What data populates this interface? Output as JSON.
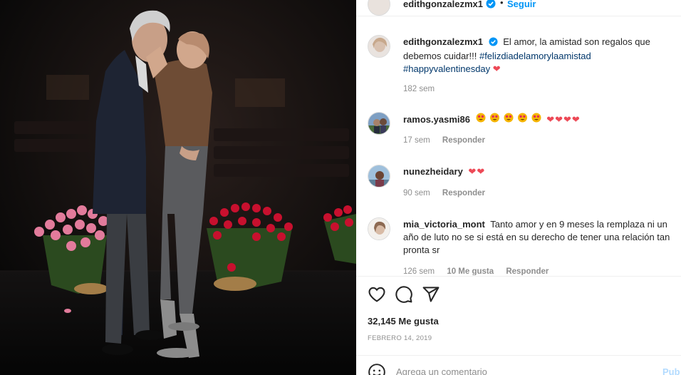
{
  "post": {
    "author": "edithgonzalezmx1",
    "follow_label": "Seguir",
    "dot": "•",
    "verified_icon": "verified-badge-icon",
    "caption": {
      "text": "El amor, la amistad son regalos que debemos cuidar!!!",
      "hashtag_1": "#felizdiadelamorylaamistad",
      "hashtag_2": "#happyvalentinesday",
      "age": "182 sem"
    },
    "comments": [
      {
        "username": "ramos.yasmi86",
        "age": "17 sem",
        "reply_label": "Responder"
      },
      {
        "username": "nunezheidary",
        "age": "90 sem",
        "reply_label": "Responder"
      },
      {
        "username": "mia_victoria_mont",
        "text": "Tanto amor y en 9 meses la remplaza ni un año de luto no se si está en su derecho de tener una relación tan pronta sr",
        "age": "126 sem",
        "likes": "10 Me gusta",
        "reply_label": "Responder"
      }
    ],
    "likes": "32,145 Me gusta",
    "date": "FEBRERO 14, 2019",
    "add_comment_placeholder": "Agrega un comentario",
    "publish_label": "Pub"
  },
  "icons": {
    "like": "heart-outline-icon",
    "comment": "comment-bubble-icon",
    "share": "paper-plane-icon",
    "emoji": "smiley-icon"
  },
  "colors": {
    "link_blue": "#0095f6",
    "hashtag": "#00376b",
    "heart_red": "#ed4956",
    "muted": "#8e8e8e"
  }
}
